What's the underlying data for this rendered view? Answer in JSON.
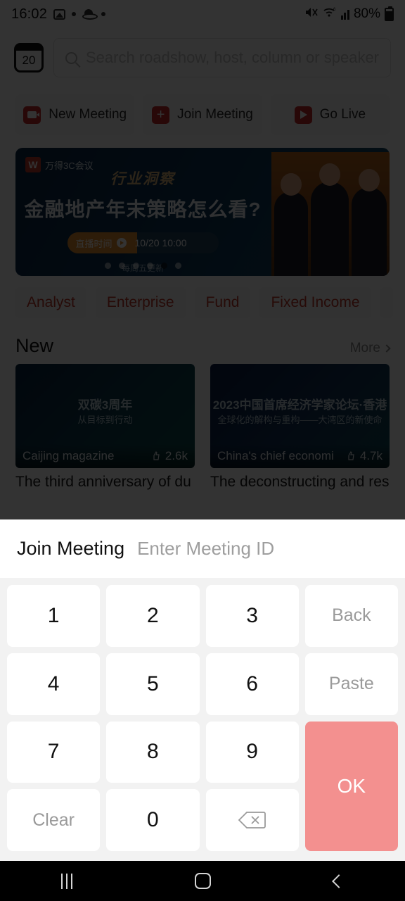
{
  "status_bar": {
    "time": "16:02",
    "battery_percent": "80%",
    "icons": [
      "photo-icon",
      "dot-icon",
      "saturn-icon",
      "dot-icon",
      "mute-icon",
      "wifi-icon",
      "signal-icon",
      "battery-icon"
    ]
  },
  "header": {
    "calendar_day": "20",
    "search_placeholder": "Search roadshow, host, column or speaker"
  },
  "actions": [
    {
      "label": "New Meeting",
      "icon": "video-camera-icon"
    },
    {
      "label": "Join Meeting",
      "icon": "plus-icon"
    },
    {
      "label": "Go Live",
      "icon": "play-icon"
    }
  ],
  "banner": {
    "logo_letter": "W",
    "logo_text": "万得3C会议",
    "kicker": "行业洞察",
    "title": "金融地产年末策略怎么看?",
    "badge_label": "直播时间",
    "badge_time": "10/20 10:00",
    "subtitle": "每周五更新",
    "dots_count": 6,
    "active_dot": 5
  },
  "chips": [
    "Analyst",
    "Enterprise",
    "Fund",
    "Fixed Income"
  ],
  "section": {
    "title": "New",
    "more_label": "More"
  },
  "cards": [
    {
      "source": "Caijing magazine",
      "likes": "2.6k",
      "title": "The third anniversary of du",
      "thumb_kicker": "双碳3周年",
      "thumb_sub": "从目标到行动"
    },
    {
      "source": "China's chief economi",
      "likes": "4.7k",
      "title": "The deconstructing and res",
      "thumb_kicker": "2023中国首席经济学家论坛·香港",
      "thumb_sub": "全球化的解构与重构——大湾区的新使命"
    }
  ],
  "modal": {
    "title": "Join Meeting",
    "input_placeholder": "Enter Meeting ID",
    "input_value": "",
    "keys": [
      {
        "label": "1",
        "type": "digit"
      },
      {
        "label": "2",
        "type": "digit"
      },
      {
        "label": "3",
        "type": "digit"
      },
      {
        "label": "Back",
        "type": "function"
      },
      {
        "label": "4",
        "type": "digit"
      },
      {
        "label": "5",
        "type": "digit"
      },
      {
        "label": "6",
        "type": "digit"
      },
      {
        "label": "Paste",
        "type": "function"
      },
      {
        "label": "7",
        "type": "digit"
      },
      {
        "label": "8",
        "type": "digit"
      },
      {
        "label": "9",
        "type": "digit"
      },
      {
        "label": "Clear",
        "type": "function"
      },
      {
        "label": "0",
        "type": "digit"
      },
      {
        "label": "backspace-icon",
        "type": "icon"
      }
    ],
    "ok_label": "OK",
    "ok_color": "#f3908f",
    "ok_enabled": false
  },
  "navbar": {
    "recents_label": "recents-icon",
    "home_label": "home-icon",
    "back_label": "back-icon"
  }
}
